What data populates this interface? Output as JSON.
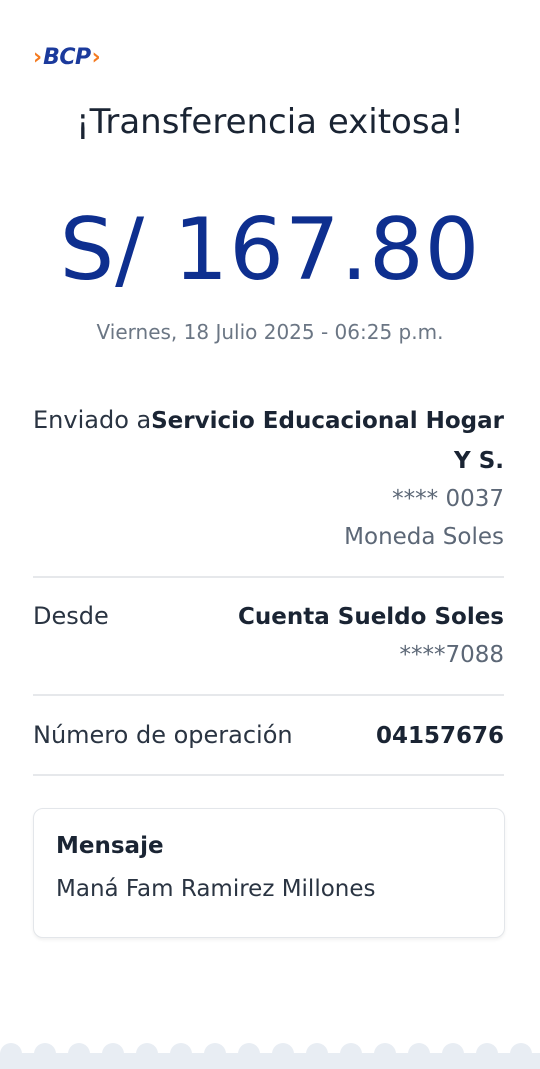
{
  "brand": {
    "logo_text": "BCP"
  },
  "title": "¡Transferencia exitosa!",
  "amount": "S/ 167.80",
  "datetime": "Viernes, 18 Julio 2025 - 06:25 p.m.",
  "recipient": {
    "label": "Enviado a",
    "name_line1": "Servicio Educacional Hogar",
    "name_line2": "Y S.",
    "account": "**** 0037",
    "currency": "Moneda Soles"
  },
  "origin": {
    "label": "Desde",
    "account_name": "Cuenta Sueldo Soles",
    "account_number": "****7088"
  },
  "operation": {
    "label": "Número de operación",
    "number": "04157676"
  },
  "message": {
    "title": "Mensaje",
    "text": "Maná Fam Ramirez Millones"
  },
  "colors": {
    "brand_blue": "#0e2f8f",
    "brand_orange": "#f47a20",
    "divider": "#e6e8eb",
    "footer_wave": "#e8edf3"
  }
}
